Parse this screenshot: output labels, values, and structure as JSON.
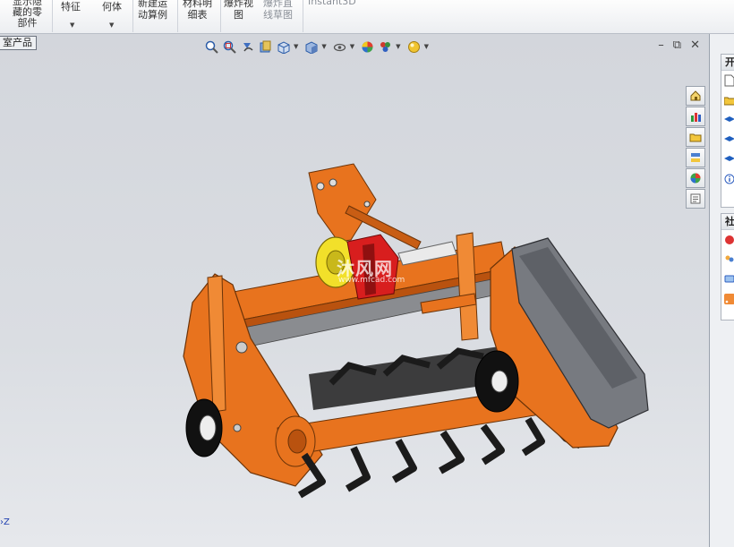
{
  "ribbon": {
    "items": [
      {
        "label": "显示隐\n藏的零\n部件"
      },
      {
        "label": "特征"
      },
      {
        "label": "何体"
      },
      {
        "label": "新建运\n动算例"
      },
      {
        "label": "材料明\n细表"
      },
      {
        "label": "爆炸视\n图"
      },
      {
        "label": "爆炸直\n线草图"
      },
      {
        "label": "Instant3D"
      }
    ]
  },
  "viewport": {
    "tree_tab": "室产品",
    "triad_label": "Z",
    "watermark": {
      "text": "沐风网",
      "url": "www.mfcad.com"
    }
  },
  "heads_up_icons": [
    "zoom-to-fit-icon",
    "zoom-area-icon",
    "previous-view-icon",
    "section-view-icon",
    "view-orientation-icon",
    "display-style-icon",
    "hide-show-items-icon",
    "edit-appearance-icon",
    "apply-scene-icon",
    "view-settings-icon"
  ],
  "window_controls": [
    "minimize-icon",
    "restore-icon",
    "close-icon"
  ],
  "task_pane": {
    "panel1_title": "开",
    "panel2_title": "社"
  },
  "colors": {
    "frame_orange": "#e8731e",
    "gear_red": "#d81e1e",
    "gear_yellow": "#f2e02a",
    "blade_black": "#1b1b1b",
    "cover_gray": "#777a80"
  }
}
